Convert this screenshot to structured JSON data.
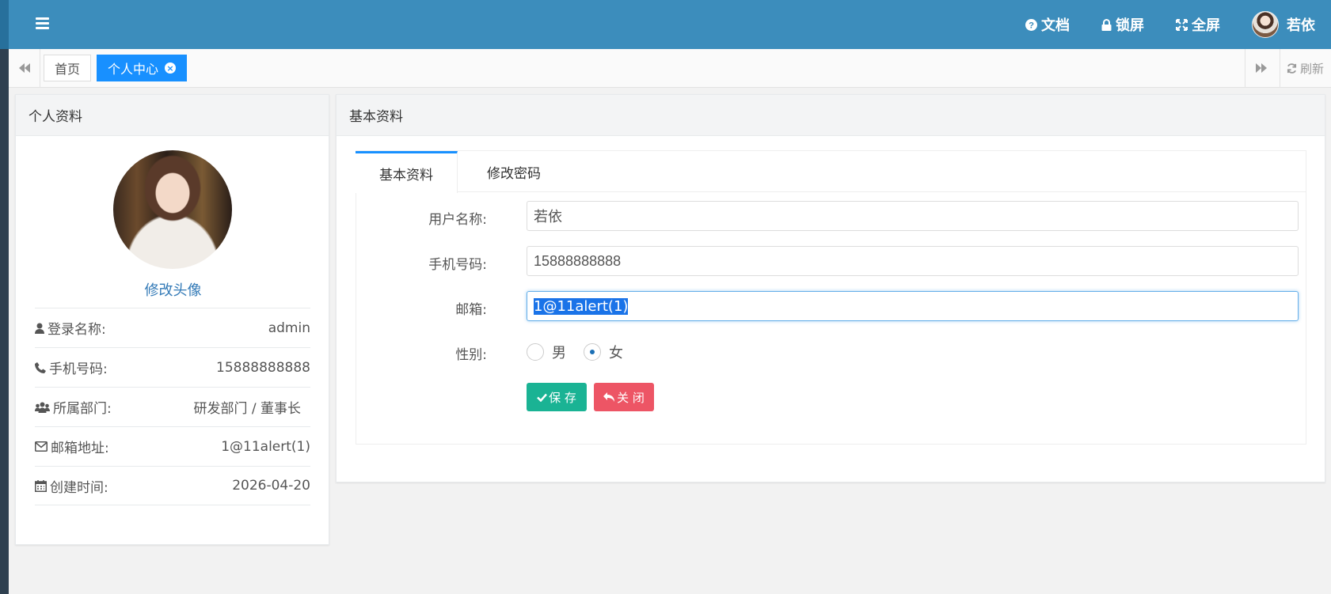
{
  "topbar": {
    "nav": [
      {
        "label": "文档",
        "icon": "question-circle-icon"
      },
      {
        "label": "锁屏",
        "icon": "lock-icon"
      },
      {
        "label": "全屏",
        "icon": "fullscreen-icon"
      }
    ],
    "user_name": "若依"
  },
  "tabsbar": {
    "tabs": [
      {
        "label": "首页"
      },
      {
        "label": "个人中心"
      }
    ],
    "refresh_label": "刷新"
  },
  "profile_panel": {
    "title": "个人资料",
    "change_avatar": "修改头像",
    "rows": [
      {
        "label": "登录名称:",
        "value": "admin",
        "icon": "user-icon"
      },
      {
        "label": "手机号码:",
        "value": "15888888888",
        "icon": "phone-icon"
      },
      {
        "label": "所属部门:",
        "value": "研发部门 / 董事长",
        "icon": "users-icon"
      },
      {
        "label": "邮箱地址:",
        "value": "1@11alert(1)",
        "icon": "envelope-icon"
      },
      {
        "label": "创建时间:",
        "value": "2026-04-20",
        "icon": "calendar-icon"
      }
    ]
  },
  "basic_panel": {
    "title": "基本资料",
    "tabs": [
      {
        "label": "基本资料"
      },
      {
        "label": "修改密码"
      }
    ],
    "form": {
      "username_label": "用户名称:",
      "username_value": "若依",
      "phone_label": "手机号码:",
      "phone_value": "15888888888",
      "email_label": "邮箱:",
      "email_value": "1@11alert(1)",
      "gender_label": "性别:",
      "gender_options": [
        "男",
        "女"
      ],
      "gender_selected": "女",
      "save_label": "保 存",
      "close_label": "关 闭"
    }
  },
  "colors": {
    "topbar": "#3c8dbc",
    "active_tab": "#1890ff",
    "save_button": "#1ab394",
    "close_button": "#ed5565",
    "link": "#337ab7"
  }
}
